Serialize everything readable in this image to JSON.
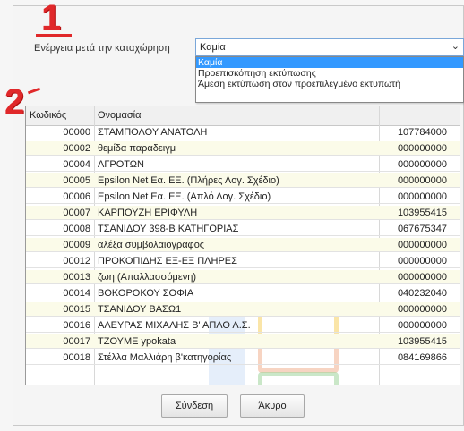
{
  "markers": {
    "one": "1",
    "two": "2"
  },
  "after_save_action": {
    "label": "Ενέργεια μετά την καταχώρηση",
    "selected": "Καμία",
    "options": [
      "Καμία",
      "Προεπισκόπηση εκτύπωσης",
      "Άμεση εκτύπωση στον προεπιλεγμένο εκτυπωτή"
    ]
  },
  "table": {
    "headers": {
      "code": "Κωδικός",
      "name": "Ονομασία"
    },
    "rows": [
      {
        "code": "00000",
        "name": "ΣΤΑΜΠΟΛΟΥ ΑΝΑΤΟΛΗ",
        "afm": "107784000"
      },
      {
        "code": "00002",
        "name": "θεμίδα παραδειγμ",
        "afm": "000000000"
      },
      {
        "code": "00004",
        "name": "ΑΓΡΟΤΩΝ",
        "afm": "000000000"
      },
      {
        "code": "00005",
        "name": "Epsilon Net Εα. ΕΞ. (Πλήρες Λογ. Σχέδιο)",
        "afm": "000000000"
      },
      {
        "code": "00006",
        "name": "Epsilon Net Εα. ΕΞ. (Απλό Λογ. Σχέδιο)",
        "afm": "000000000"
      },
      {
        "code": "00007",
        "name": "ΚΑΡΠΟΥΖΗ ΕΡΙΦΥΛΗ",
        "afm": "103955415"
      },
      {
        "code": "00008",
        "name": "ΤΣΑΝΙΔΟΥ 398-Β ΚΑΤΗΓΟΡΙΑΣ",
        "afm": "067675347"
      },
      {
        "code": "00009",
        "name": "αλέξα συμβολαιογραφος",
        "afm": "000000000"
      },
      {
        "code": "00012",
        "name": "ΠΡΟΚΟΠΙΔΗΣ ΕΞ-ΕΞ ΠΛΗΡΕΣ",
        "afm": "000000000"
      },
      {
        "code": "00013",
        "name": "ζωη (Απαλλασσόμενη)",
        "afm": "000000000"
      },
      {
        "code": "00014",
        "name": "ΒΟΚΟΡΟΚΟΥ ΣΟΦΙΑ",
        "afm": "040232040"
      },
      {
        "code": "00015",
        "name": "ΤΣΑΝΙΔΟΥ ΒΑΣΩ1",
        "afm": "000000000"
      },
      {
        "code": "00016",
        "name": "ΑΛΕΥΡΑΣ ΜΙΧΑΛΗΣ Β' ΑΠΛΟ Λ.Σ.",
        "afm": "000000000"
      },
      {
        "code": "00017",
        "name": "ΤΖΟΥΜΕ ypokata",
        "afm": "103955415"
      },
      {
        "code": "00018",
        "name": "Στέλλα Μαλλιάρη β'κατηγορίας",
        "afm": "084169866"
      }
    ]
  },
  "buttons": {
    "connect": "Σύνδεση",
    "cancel": "Άκυρο"
  },
  "colors": {
    "marker": "#e0282a",
    "selection": "#3399ff",
    "row_alt": "#fbfbe9"
  }
}
